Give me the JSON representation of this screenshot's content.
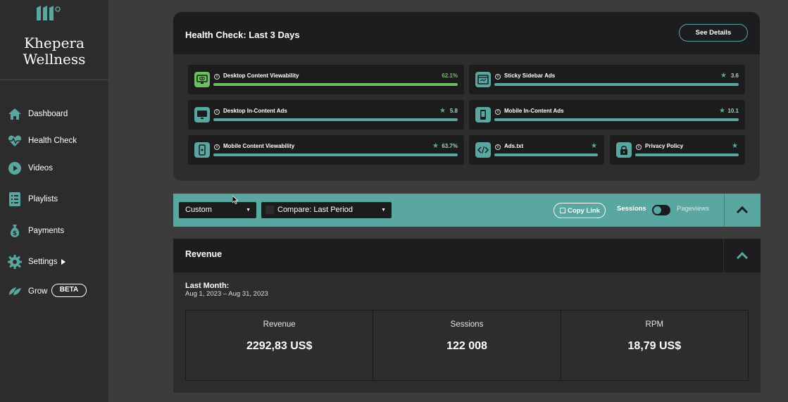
{
  "sidebar": {
    "brand": "Khepera Wellness",
    "items": [
      {
        "label": "Dashboard",
        "icon": "home-icon"
      },
      {
        "label": "Health Check",
        "icon": "heartbeat-icon"
      },
      {
        "label": "Videos",
        "icon": "play-icon"
      },
      {
        "label": "Playlists",
        "icon": "checklist-icon"
      },
      {
        "label": "Payments",
        "icon": "money-bag-icon"
      },
      {
        "label": "Settings",
        "icon": "gear-icon"
      },
      {
        "label": "Grow",
        "icon": "leaf-icon",
        "badge": "BETA"
      }
    ]
  },
  "health": {
    "title": "Health Check: Last 3 Days",
    "see_details": "See Details",
    "cards": [
      {
        "label": "Desktop Content Viewability",
        "value": "62.1%",
        "status": "good",
        "icon": "monitor-eye-icon"
      },
      {
        "label": "Sticky Sidebar Ads",
        "value": "3.6",
        "status": "rated",
        "icon": "browser-window-icon"
      },
      {
        "label": "Desktop In-Content Ads",
        "value": "5.8",
        "status": "rated",
        "icon": "monitor-icon"
      },
      {
        "label": "Mobile In-Content Ads",
        "value": "10.1",
        "status": "rated",
        "icon": "mobile-icon"
      },
      {
        "label": "Mobile Content Viewability",
        "value": "63.7%",
        "status": "rated",
        "icon": "mobile-eye-icon"
      },
      {
        "label": "Ads.txt",
        "value": "",
        "status": "rated",
        "icon": "code-icon"
      },
      {
        "label": "Privacy Policy",
        "value": "",
        "status": "rated",
        "icon": "lock-icon"
      }
    ]
  },
  "filters": {
    "range": "Custom",
    "compare": "Compare: Last Period",
    "copy_link": "Copy Link",
    "sessions": "Sessions",
    "pageviews": "Pageviews"
  },
  "revenue": {
    "title": "Revenue",
    "period_label": "Last Month:",
    "period_range": "Aug 1, 2023 – Aug 31, 2023",
    "stats": [
      {
        "label": "Revenue",
        "value": "2292,83 US$"
      },
      {
        "label": "Sessions",
        "value": "122 008"
      },
      {
        "label": "RPM",
        "value": "18,79 US$"
      }
    ]
  },
  "colors": {
    "accent": "#5aa6a0",
    "good": "#6cc061",
    "sidebar": "#2c2c2c",
    "panel_header": "#1d1c1e"
  }
}
